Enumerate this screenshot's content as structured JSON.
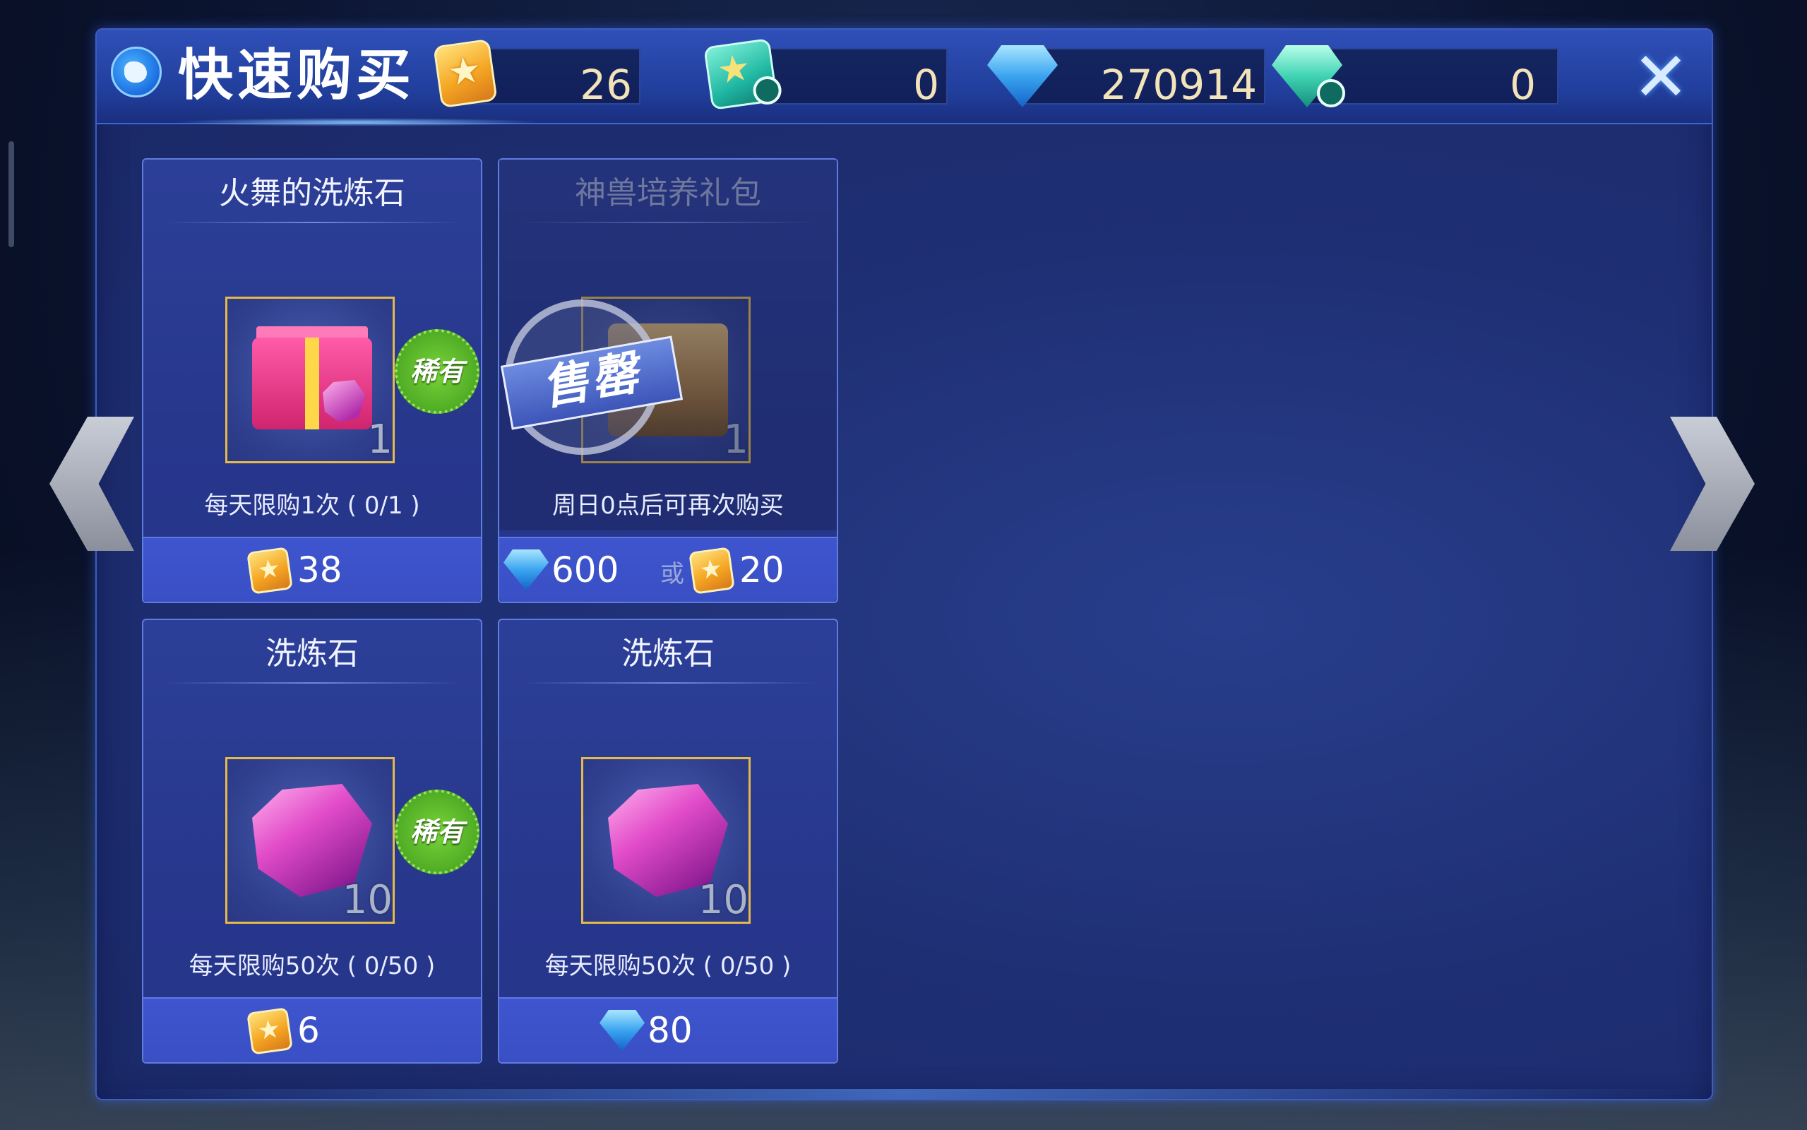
{
  "header": {
    "title": "快速购买",
    "close_label": "✕"
  },
  "currencies": [
    {
      "icon": "gold-star-icon",
      "value": "26"
    },
    {
      "icon": "timed-gold-star-icon",
      "value": "0"
    },
    {
      "icon": "diamond-icon",
      "value": "270914"
    },
    {
      "icon": "timed-diamond-icon",
      "value": "0"
    }
  ],
  "items": [
    {
      "name": "火舞的洗炼石",
      "quantity": "1",
      "badge": "稀有",
      "limit": "每天限购1次 ( 0/1 )",
      "price": "38",
      "price_currency": "gold"
    },
    {
      "name": "神兽培养礼包",
      "quantity": "1",
      "soldout": "售罄",
      "limit": "周日0点后可再次购买",
      "price_diamond": "600",
      "or_label": "或",
      "price_gold": "20"
    },
    {
      "name": "洗炼石",
      "quantity": "10",
      "badge": "稀有",
      "limit": "每天限购50次 ( 0/50 )",
      "price": "6",
      "price_currency": "gold"
    },
    {
      "name": "洗炼石",
      "quantity": "10",
      "limit": "每天限购50次 ( 0/50 )",
      "price": "80",
      "price_currency": "diamond"
    }
  ],
  "colors": {
    "panel": "#1f2f74",
    "card": "#2c3f98",
    "price_bar": "#3e55cf",
    "slot_border": "#e5b94a",
    "rare_badge": "#5bb82a",
    "currency_text": "#f2e3b8"
  }
}
